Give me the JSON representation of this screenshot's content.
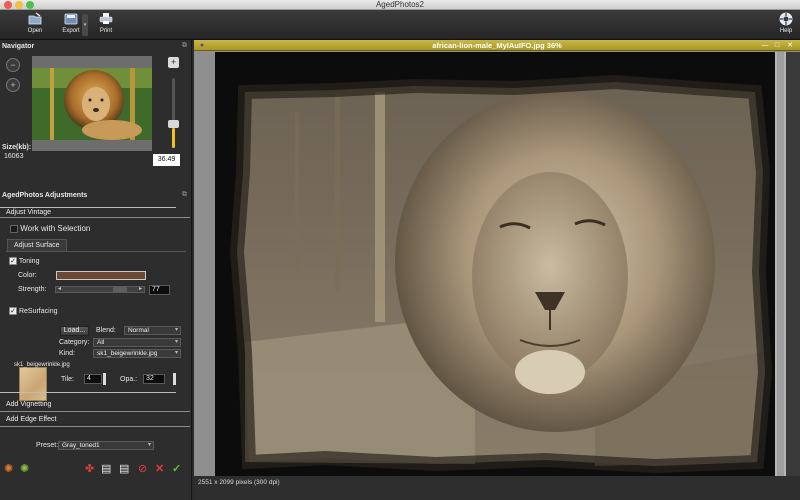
{
  "app": {
    "title": "AgedPhotos2"
  },
  "toolbar": {
    "open": {
      "label": "Open",
      "icon": "open-icon"
    },
    "export": {
      "label": "Export",
      "icon": "export-icon"
    },
    "print": {
      "label": "Print",
      "icon": "print-icon"
    },
    "help": {
      "label": "Help",
      "icon": "help-icon"
    }
  },
  "navigator": {
    "title": "Navigator",
    "size_label": "Size(kb):",
    "size_value": "16063",
    "zoom_value": "36.49"
  },
  "adjustments": {
    "title": "AgedPhotos Adjustments",
    "vintage_tab": "Adjust Vintage",
    "work_with_selection": "Work with Selection",
    "surface_tab": "Adjust Surface",
    "toning": {
      "label": "Toning",
      "checked": true,
      "color_label": "Color:",
      "color": "#6b4a35",
      "strength_label": "Strength:",
      "strength": "77",
      "strength_fraction": 0.77
    },
    "resurfacing": {
      "label": "ReSurfacing",
      "checked": true,
      "load_label": "Load...",
      "blend_label": "Blend:",
      "blend_value": "Normal",
      "category_label": "Category:",
      "category_value": "All",
      "kind_label": "Kind:",
      "kind_value": "sk1_beigewrinkle.jpg",
      "thumb_caption": "sk1_beigewrinkle.jpg",
      "tile_label": "Tile:",
      "tile_value": "4",
      "opacity_label": "Opa.:",
      "opacity_value": "32"
    },
    "vignetting_tab": "Add Vignetting",
    "edge_tab": "Add Edge Effect",
    "preset_label": "Preset:",
    "preset_value": "Gray_toned1"
  },
  "document": {
    "title": "african-lion-male_MyIAuIFO.jpg 36%",
    "status": "2551 x 2099 pixels (300 dpi)"
  },
  "colors": {
    "accent": "#f0c020",
    "doc_title_bar": "#b5a42a",
    "panel": "#2d2d2d"
  }
}
